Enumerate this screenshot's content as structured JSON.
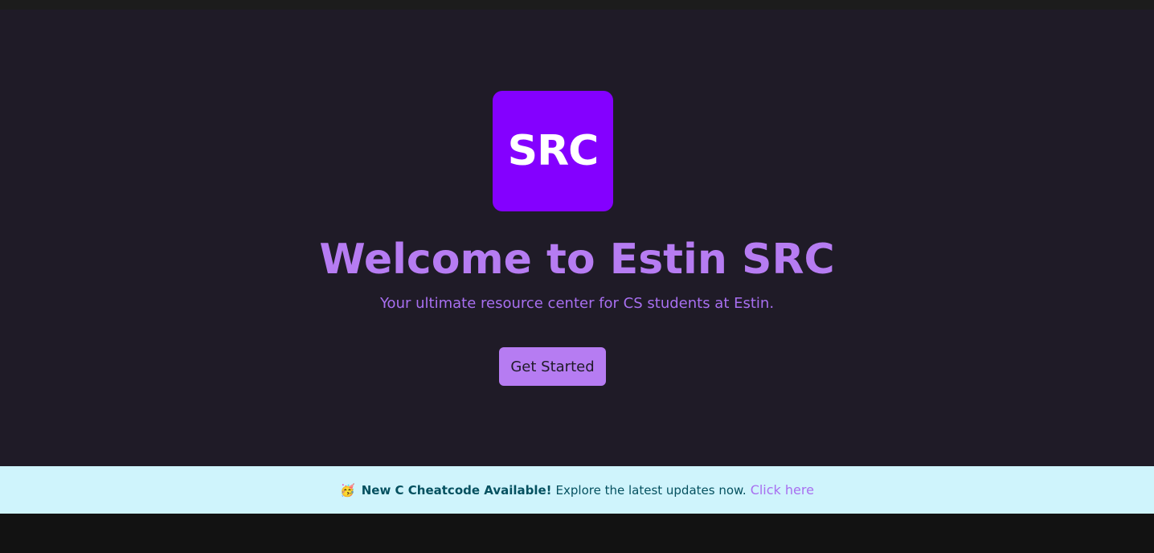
{
  "hero": {
    "logo_text": "SRC",
    "title": "Welcome to Estin SRC",
    "subtitle": "Your ultimate resource center for CS students at Estin.",
    "cta_label": "Get Started"
  },
  "banner": {
    "emoji": "🥳",
    "headline": "New C Cheatcode Available!",
    "message": "Explore the latest updates now.",
    "link_label": "Click here"
  },
  "colors": {
    "background": "#1f1b27",
    "accent": "#b67cf2",
    "logo": "#8400ff",
    "banner_bg": "#cff4fc",
    "banner_text": "#055160"
  }
}
